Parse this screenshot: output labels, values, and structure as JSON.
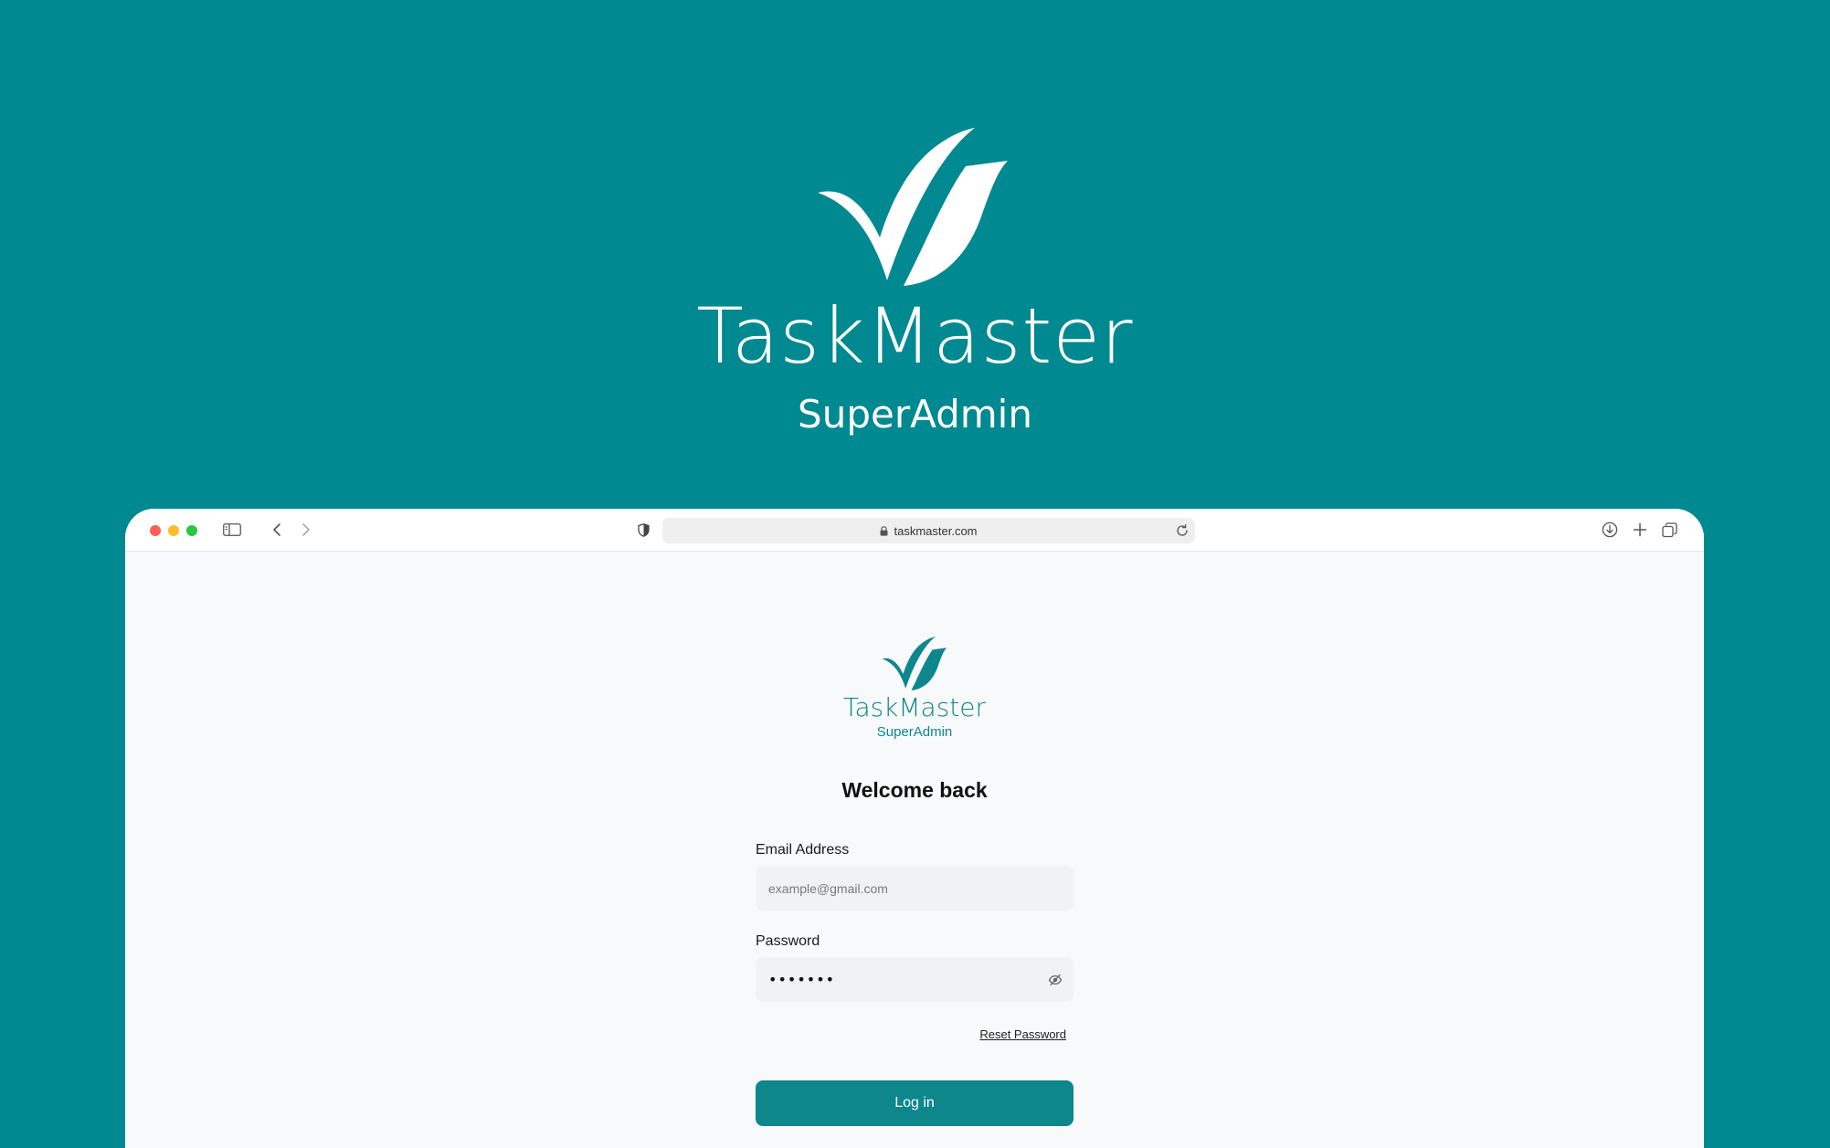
{
  "brand": {
    "name": "TaskMaster",
    "subtitle": "SuperAdmin"
  },
  "browser": {
    "url": "taskmaster.com",
    "icons": {
      "sidebar": "sidebar-icon",
      "back": "chevron-left-icon",
      "forward": "chevron-right-icon",
      "shield": "shield-icon",
      "lock": "lock-icon",
      "reload": "reload-icon",
      "download": "download-icon",
      "new_tab": "plus-icon",
      "tabs": "tabs-overview-icon"
    }
  },
  "login": {
    "heading": "Welcome back",
    "email": {
      "label": "Email Address",
      "placeholder": "example@gmail.com",
      "value": ""
    },
    "password": {
      "label": "Password",
      "masked_value": "•••••••",
      "toggle_icon": "eye-off-icon"
    },
    "reset_link": "Reset Password",
    "submit_label": "Log in"
  },
  "colors": {
    "background": "#008990",
    "brand_teal": "#0d868c",
    "page_background": "#f8f9fa",
    "input_background": "#f1f2f3"
  }
}
